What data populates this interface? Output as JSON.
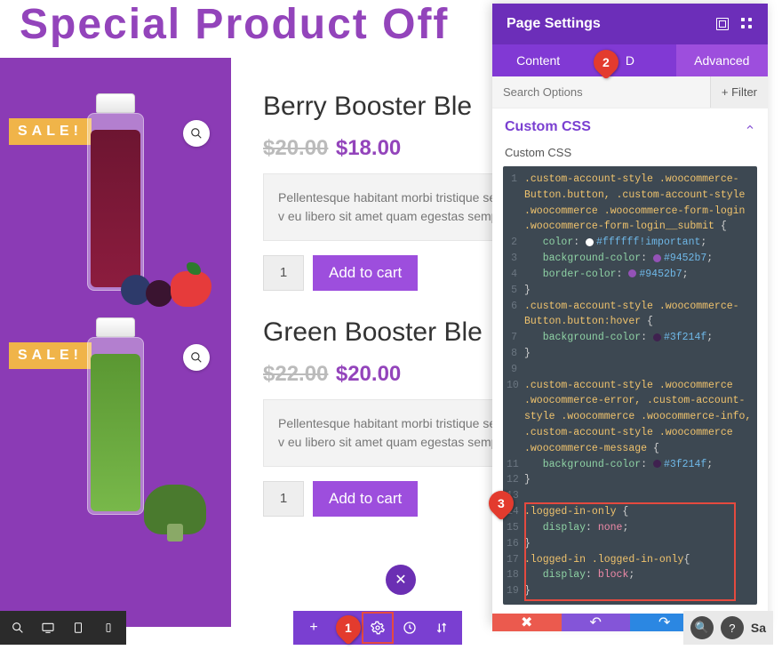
{
  "header": {
    "title": "Special Product Off"
  },
  "sidebar": {
    "products": [
      {
        "sale": "SALE!",
        "variant": "berry"
      },
      {
        "sale": "SALE!",
        "variant": "green"
      }
    ]
  },
  "content": {
    "products": [
      {
        "title": "Berry Booster Ble",
        "old_price": "$20.00",
        "new_price": "$18.00",
        "description": "Pellentesque habitant morbi tristique sene egestas. Vestibulum tortor quam, feugiat v eu libero sit amet quam egestas semper. A eleifend leo.",
        "qty": "1",
        "button": "Add to cart"
      },
      {
        "title": "Green Booster Ble",
        "old_price": "$22.00",
        "new_price": "$20.00",
        "description": "Pellentesque habitant morbi tristique sene egestas. Vestibulum tortor quam, feugiat v eu libero sit amet quam egestas semper. A eleifend leo.",
        "qty": "1",
        "button": "Add to cart"
      }
    ]
  },
  "settings": {
    "title": "Page Settings",
    "tabs": [
      "Content",
      "D",
      "Advanced"
    ],
    "search_placeholder": "Search Options",
    "filter_label": "+ Filter",
    "section": "Custom CSS",
    "field_label": "Custom CSS",
    "code": [
      {
        "n": "1",
        "t": "sel",
        "s": ".custom-account-style .woocommerce-Button.button, .custom-account-style .woocommerce .woocommerce-form-login .woocommerce-form-login__submit {"
      },
      {
        "n": "2",
        "t": "rule",
        "p": "color",
        "v": "#ffffff!important",
        "dot": "#ffffff"
      },
      {
        "n": "3",
        "t": "rule",
        "p": "background-color",
        "v": "#9452b7",
        "dot": "#9452b7"
      },
      {
        "n": "4",
        "t": "rule",
        "p": "border-color",
        "v": "#9452b7",
        "dot": "#9452b7"
      },
      {
        "n": "5",
        "t": "close"
      },
      {
        "n": "6",
        "t": "sel",
        "s": ".custom-account-style .woocommerce-Button.button:hover {"
      },
      {
        "n": "7",
        "t": "rule",
        "p": "background-color",
        "v": "#3f214f",
        "dot": "#3f214f"
      },
      {
        "n": "8",
        "t": "close"
      },
      {
        "n": "9",
        "t": "blank"
      },
      {
        "n": "10",
        "t": "sel",
        "s": ".custom-account-style .woocommerce .woocommerce-error, .custom-account-style .woocommerce .woocommerce-info, .custom-account-style .woocommerce .woocommerce-message {"
      },
      {
        "n": "11",
        "t": "rule",
        "p": "background-color",
        "v": "#3f214f",
        "dot": "#3f214f"
      },
      {
        "n": "12",
        "t": "close"
      },
      {
        "n": "13",
        "t": "blank"
      },
      {
        "n": "14",
        "t": "sel",
        "s": ".logged-in-only {"
      },
      {
        "n": "15",
        "t": "rule",
        "p": "display",
        "v": "none"
      },
      {
        "n": "16",
        "t": "close"
      },
      {
        "n": "17",
        "t": "sel",
        "s": ".logged-in .logged-in-only{"
      },
      {
        "n": "18",
        "t": "rule",
        "p": "display",
        "v": "block"
      },
      {
        "n": "19",
        "t": "close"
      }
    ]
  },
  "annotations": {
    "a1": "1",
    "a2": "2",
    "a3": "3"
  },
  "bottom_right": {
    "save": "Sa"
  }
}
